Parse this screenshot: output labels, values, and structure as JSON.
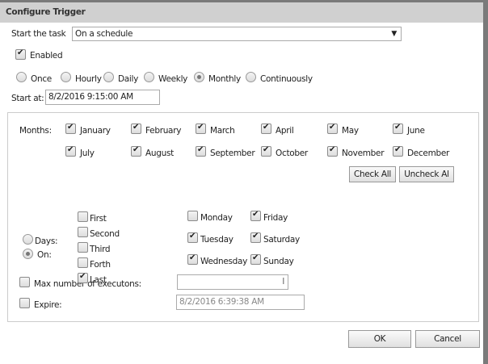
{
  "title": "Configure Trigger",
  "start_task": {
    "label": "Start the task",
    "value": "On a schedule"
  },
  "enabled": {
    "label": "Enabled",
    "checked": true
  },
  "frequency": {
    "options": [
      "Once",
      "Hourly",
      "Daily",
      "Weekly",
      "Monthly",
      "Continuously"
    ],
    "selected": "Monthly"
  },
  "start_at": {
    "label": "Start at:",
    "value": "8/2/2016 9:15:00 AM"
  },
  "months": {
    "label": "Months:",
    "items": [
      {
        "name": "January",
        "checked": true
      },
      {
        "name": "February",
        "checked": true
      },
      {
        "name": "March",
        "checked": true
      },
      {
        "name": "April",
        "checked": true
      },
      {
        "name": "May",
        "checked": true
      },
      {
        "name": "June",
        "checked": true
      },
      {
        "name": "July",
        "checked": true
      },
      {
        "name": "August",
        "checked": true
      },
      {
        "name": "September",
        "checked": true
      },
      {
        "name": "October",
        "checked": true
      },
      {
        "name": "November",
        "checked": true
      },
      {
        "name": "December",
        "checked": true
      }
    ],
    "check_all": "Check All",
    "uncheck_all": "Uncheck Al"
  },
  "mode": {
    "days_label": "Days:",
    "on_label": "On:",
    "selected": "On"
  },
  "weeks": [
    {
      "name": "First",
      "checked": false
    },
    {
      "name": "Second",
      "checked": false
    },
    {
      "name": "Third",
      "checked": false
    },
    {
      "name": "Forth",
      "checked": false
    },
    {
      "name": "Last",
      "checked": true
    }
  ],
  "weekdays": [
    {
      "name": "Monday",
      "checked": false
    },
    {
      "name": "Tuesday",
      "checked": true
    },
    {
      "name": "Wednesday",
      "checked": true
    },
    {
      "name": "Friday",
      "checked": true
    },
    {
      "name": "Saturday",
      "checked": true
    },
    {
      "name": "Sunday",
      "checked": true
    }
  ],
  "max_exec": {
    "label": "Max number of executons:",
    "value": "l",
    "checked": false
  },
  "expire": {
    "label": "Expire:",
    "value": "8/2/2016 6:39:38 AM",
    "checked": false
  },
  "ok": "OK",
  "cancel": "Cancel"
}
